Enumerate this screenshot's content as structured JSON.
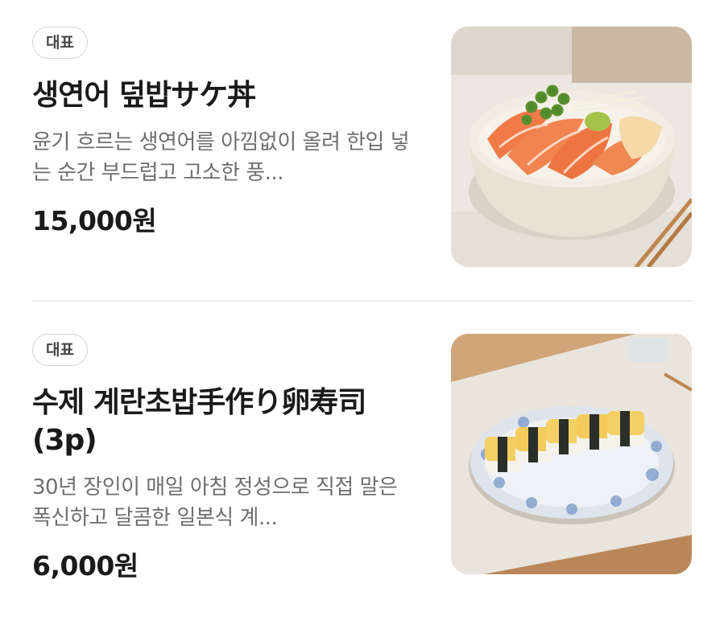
{
  "menu": {
    "items": [
      {
        "badge": "대표",
        "title": "생연어 덮밥サケ丼",
        "description": "윤기 흐르는 생연어를 아낌없이 올려 한입 넣는 순간 부드럽고 고소한 풍...",
        "price": "15,000원",
        "image_icon": "salmon-rice-bowl"
      },
      {
        "badge": "대표",
        "title": "수제 계란초밥手作り卵寿司(3p)",
        "description": "30년 장인이 매일 아침 정성으로 직접 말은 폭신하고 달콤한 일본식 계...",
        "price": "6,000원",
        "image_icon": "tamago-sushi-plate"
      }
    ]
  }
}
